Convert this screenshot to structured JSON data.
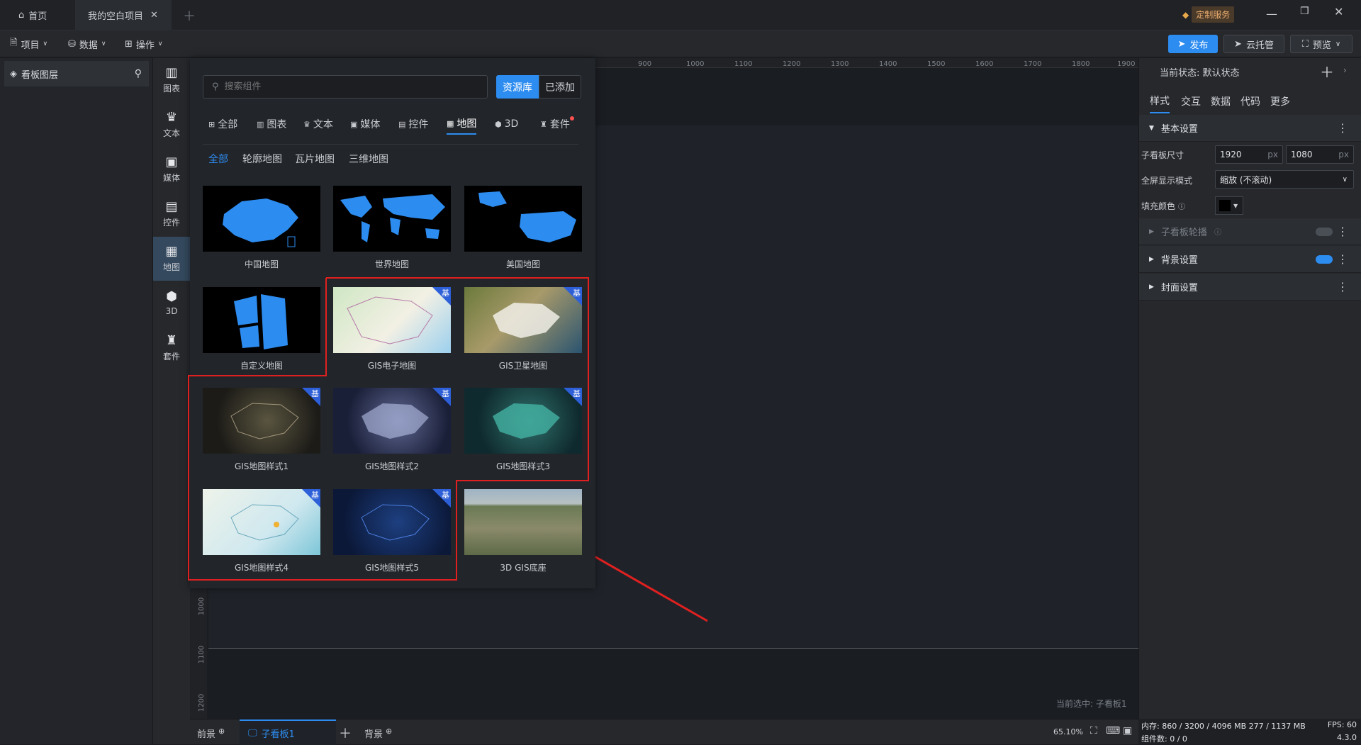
{
  "titlebar": {
    "tabs": [
      {
        "label": "首页",
        "icon": "home-icon"
      },
      {
        "label": "我的空白项目",
        "icon": "close-icon"
      }
    ],
    "service_label": "定制服务"
  },
  "toolbar": {
    "menus": [
      {
        "label": "项目"
      },
      {
        "label": "数据"
      },
      {
        "label": "操作"
      }
    ],
    "publish": "发布",
    "hosting": "云托管",
    "preview": "预览"
  },
  "layers": {
    "title": "看板图层"
  },
  "categories": [
    {
      "label": "图表",
      "icon": "chart-icon"
    },
    {
      "label": "文本",
      "icon": "text-icon"
    },
    {
      "label": "媒体",
      "icon": "media-icon"
    },
    {
      "label": "控件",
      "icon": "control-icon"
    },
    {
      "label": "地图",
      "icon": "map-icon"
    },
    {
      "label": "3D",
      "icon": "cube-icon"
    },
    {
      "label": "套件",
      "icon": "kit-icon"
    }
  ],
  "panel": {
    "search_placeholder": "搜索组件",
    "source_lib": "资源库",
    "added": "已添加",
    "filter_tabs": [
      "全部",
      "图表",
      "文本",
      "媒体",
      "控件",
      "地图",
      "3D",
      "套件"
    ],
    "sub_tabs": [
      "全部",
      "轮廓地图",
      "瓦片地图",
      "三维地图"
    ],
    "badge": "基",
    "cards": [
      {
        "label": "中国地图"
      },
      {
        "label": "世界地图"
      },
      {
        "label": "美国地图"
      },
      {
        "label": "自定义地图"
      },
      {
        "label": "GIS电子地图"
      },
      {
        "label": "GIS卫星地图"
      },
      {
        "label": "GIS地图样式1"
      },
      {
        "label": "GIS地图样式2"
      },
      {
        "label": "GIS地图样式3"
      },
      {
        "label": "GIS地图样式4"
      },
      {
        "label": "GIS地图样式5"
      },
      {
        "label": "3D GIS底座"
      }
    ]
  },
  "ruler": {
    "top": [
      "900",
      "1000",
      "1100",
      "1200",
      "1300",
      "1400",
      "1500",
      "1600",
      "1700",
      "1800",
      "1900"
    ],
    "left": [
      "1000",
      "1100",
      "1200"
    ]
  },
  "canvas": {
    "selected_label": "当前选中: 子看板1"
  },
  "bottom": {
    "foreground": "前景",
    "board": "子看板1",
    "background": "背景",
    "zoom": "65.10%"
  },
  "right": {
    "state_label": "当前状态: 默认状态",
    "tabs": [
      "样式",
      "交互",
      "数据",
      "代码",
      "更多"
    ],
    "basic": "基本设置",
    "size_label": "子看板尺寸",
    "width": "1920",
    "height": "1080",
    "unit": "px",
    "mode_label": "全屏显示模式",
    "mode_value": "缩放 (不滚动)",
    "fill_label": "填充颜色",
    "carousel": "子看板轮播",
    "bg": "背景设置",
    "cover": "封面设置"
  },
  "status": {
    "mem": "内存: 860 / 3200 / 4096 MB 277 / 1137 MB",
    "fps": "FPS: 60",
    "count": "组件数: 0 / 0",
    "version": "4.3.0"
  },
  "colors": {
    "accent": "#2d8cf0",
    "annotation": "#e02020",
    "badge": "#2d5fd8"
  }
}
